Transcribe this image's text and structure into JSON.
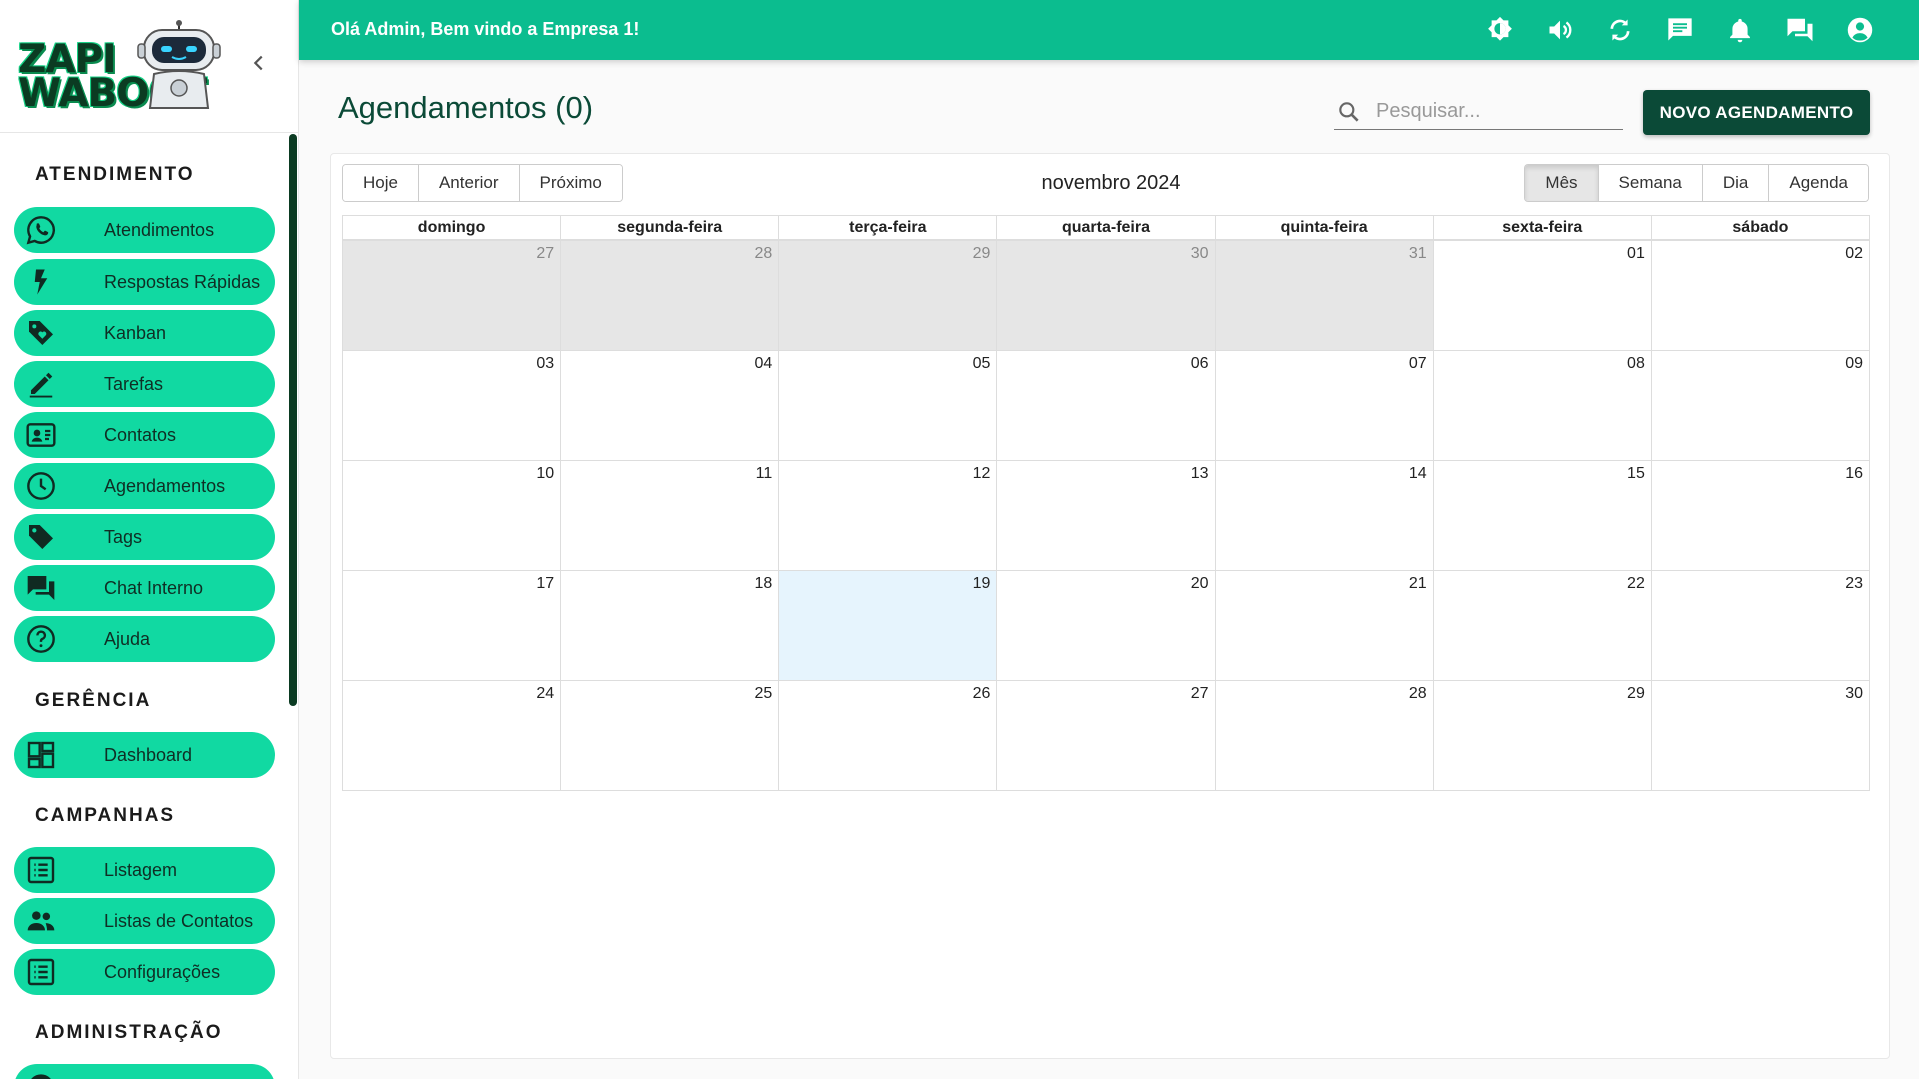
{
  "app": {
    "logo_line1": "ZAPI",
    "logo_line2": "WABOOT",
    "greeting": "Olá Admin, Bem vindo a Empresa 1!"
  },
  "sidebar": {
    "sections": [
      {
        "title": "ATENDIMENTO",
        "items": [
          {
            "label": "Atendimentos",
            "icon": "whatsapp-icon"
          },
          {
            "label": "Respostas Rápidas",
            "icon": "flash-icon"
          },
          {
            "label": "Kanban",
            "icon": "tag-heart-icon"
          },
          {
            "label": "Tarefas",
            "icon": "pencil-icon"
          },
          {
            "label": "Contatos",
            "icon": "contact-card-icon"
          },
          {
            "label": "Agendamentos",
            "icon": "clock-icon"
          },
          {
            "label": "Tags",
            "icon": "tag-icon"
          },
          {
            "label": "Chat Interno",
            "icon": "forum-icon"
          },
          {
            "label": "Ajuda",
            "icon": "help-icon"
          }
        ]
      },
      {
        "title": "GERÊNCIA",
        "items": [
          {
            "label": "Dashboard",
            "icon": "dashboard-icon"
          }
        ]
      },
      {
        "title": "CAMPANHAS",
        "items": [
          {
            "label": "Listagem",
            "icon": "list-icon"
          },
          {
            "label": "Listas de Contatos",
            "icon": "people-icon"
          },
          {
            "label": "Configurações",
            "icon": "list-settings-icon"
          }
        ]
      },
      {
        "title": "ADMINISTRAÇÃO",
        "items": []
      }
    ]
  },
  "topbar_icons": [
    "brightness-icon",
    "volume-icon",
    "sync-icon",
    "chat-icon",
    "bell-icon",
    "forum-icon",
    "account-icon"
  ],
  "page": {
    "title": "Agendamentos (0)",
    "search_placeholder": "Pesquisar...",
    "new_button": "NOVO AGENDAMENTO"
  },
  "calendar": {
    "nav_buttons": [
      "Hoje",
      "Anterior",
      "Próximo"
    ],
    "month_label": "novembro 2024",
    "views": [
      "Mês",
      "Semana",
      "Dia",
      "Agenda"
    ],
    "active_view": "Mês",
    "weekdays": [
      "domingo",
      "segunda-feira",
      "terça-feira",
      "quarta-feira",
      "quinta-feira",
      "sexta-feira",
      "sábado"
    ],
    "weeks": [
      [
        "27",
        "28",
        "29",
        "30",
        "31",
        "01",
        "02"
      ],
      [
        "03",
        "04",
        "05",
        "06",
        "07",
        "08",
        "09"
      ],
      [
        "10",
        "11",
        "12",
        "13",
        "14",
        "15",
        "16"
      ],
      [
        "17",
        "18",
        "19",
        "20",
        "21",
        "22",
        "23"
      ],
      [
        "24",
        "25",
        "26",
        "27",
        "28",
        "29",
        "30"
      ]
    ],
    "off_range_first_week_count": 5,
    "today": "19"
  },
  "colors": {
    "accent": "#11d9a2",
    "topbar": "#0bbd8f",
    "dark_green": "#0b4a37"
  }
}
